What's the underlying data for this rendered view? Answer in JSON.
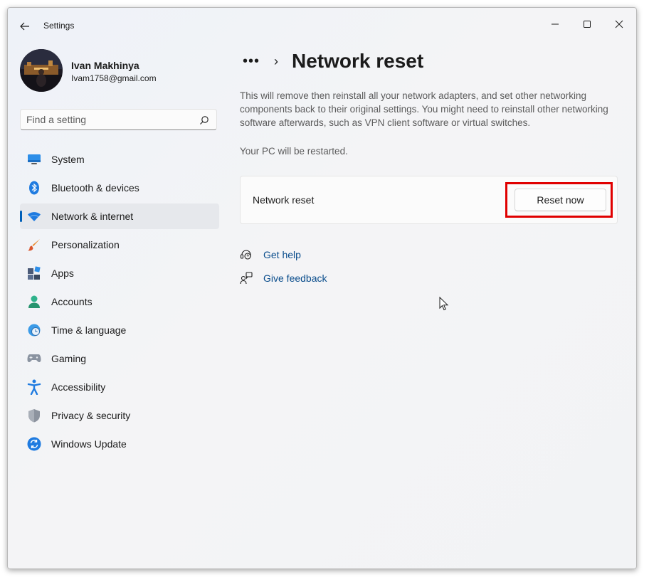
{
  "window": {
    "title": "Settings"
  },
  "profile": {
    "name": "Ivan Makhinya",
    "email": "Ivam1758@gmail.com"
  },
  "search": {
    "placeholder": "Find a setting"
  },
  "nav": {
    "items": [
      {
        "label": "System",
        "icon": "system-icon"
      },
      {
        "label": "Bluetooth & devices",
        "icon": "bluetooth-icon"
      },
      {
        "label": "Network & internet",
        "icon": "wifi-icon",
        "selected": true
      },
      {
        "label": "Personalization",
        "icon": "brush-icon"
      },
      {
        "label": "Apps",
        "icon": "apps-icon"
      },
      {
        "label": "Accounts",
        "icon": "person-icon"
      },
      {
        "label": "Time & language",
        "icon": "clock-globe-icon"
      },
      {
        "label": "Gaming",
        "icon": "gamepad-icon"
      },
      {
        "label": "Accessibility",
        "icon": "accessibility-icon"
      },
      {
        "label": "Privacy & security",
        "icon": "shield-icon"
      },
      {
        "label": "Windows Update",
        "icon": "update-icon"
      }
    ]
  },
  "main": {
    "breadcrumb_more": "•••",
    "breadcrumb_separator": "›",
    "title": "Network reset",
    "description": "This will remove then reinstall all your network adapters, and set other networking components back to their original settings. You might need to reinstall other networking software afterwards, such as VPN client software or virtual switches.",
    "restart_note": "Your PC will be restarted.",
    "card": {
      "label": "Network reset",
      "button": "Reset now"
    },
    "links": [
      {
        "label": "Get help",
        "icon": "help-icon"
      },
      {
        "label": "Give feedback",
        "icon": "feedback-icon"
      }
    ]
  },
  "colors": {
    "accent": "#005fb8",
    "highlight": "#e00000",
    "link": "#0a4d8c"
  }
}
